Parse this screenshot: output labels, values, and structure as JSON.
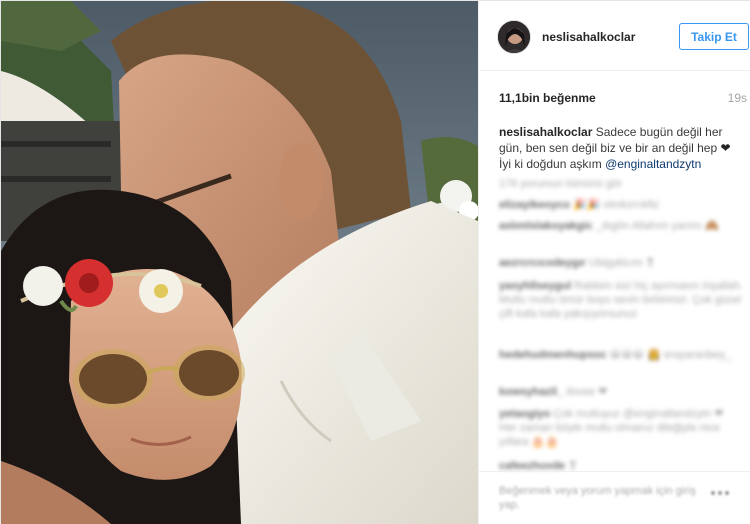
{
  "header": {
    "username": "neslisahalkoclar",
    "follow_label": "Takip Et"
  },
  "stats": {
    "likes": "11,1bin beğenme",
    "time": "19s"
  },
  "caption": {
    "username": "neslisahalkoclar",
    "text": "Sadece bugün değil her gün, ben sen değil biz ve bir an değil hep",
    "heart": "❤",
    "text2": "İyi ki doğdun aşkım",
    "mention": "@enginaltandzytn"
  },
  "comments": {
    "view_all": "176 yorumun tümünü gör",
    "items": [
      {
        "user": "elizayikeoyco",
        "text": "🎉🎉 olmkzrrıkfiz"
      },
      {
        "user": "aslımlslakoyakgic",
        "text": "_dıgön Allahım yarımı 🙈"
      },
      {
        "user": "aezrcrcıcııdeygır",
        "text": "Ubigyklcım ❣"
      },
      {
        "user": "yasyhllseygul",
        "text": "Rabbim sizi hiç ayırmasın inşallah. Mutlu mutlu ömür boyu sevin birbirinizi. Çok güzel çift kafa kafa yakışıyorsunuz"
      },
      {
        "user": "hedehudmenhupsoc",
        "text": "😀😀😀 👸 erayaranbey_"
      },
      {
        "user": "kowsyhazil_",
        "text": "ilovee ❤"
      },
      {
        "user": "yetaogiyo",
        "text": "Çok mutluyuz @enginaltandzytn ❤ Her zaman böyle mutlu olmanız dileğiyle nice yıllara 🎂🎂"
      },
      {
        "user": "cafeezhuvde",
        "text": "❣"
      }
    ]
  },
  "footer": {
    "comment_placeholder": "Beğenmek veya yorum yapmak için giriş yap."
  },
  "colors": {
    "accent": "#3897f0",
    "link": "#003569",
    "muted": "#a5a5a5"
  },
  "icons": {
    "more": "more-options-icon"
  }
}
